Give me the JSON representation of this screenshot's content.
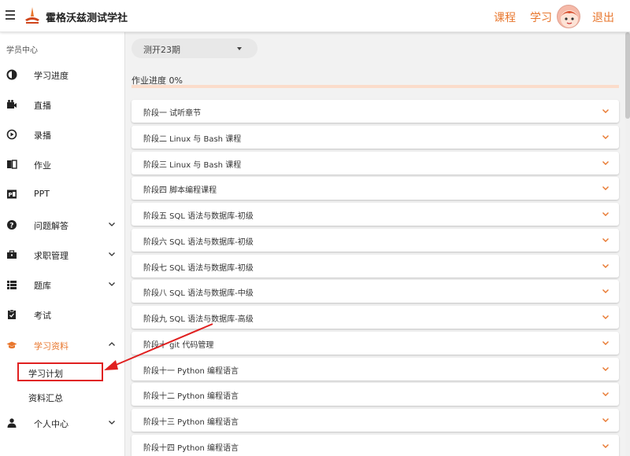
{
  "header": {
    "title": "霍格沃兹测试学社",
    "nav_course": "课程",
    "nav_study": "学习",
    "nav_logout": "退出",
    "accent_color": "#e8772e"
  },
  "sidebar": {
    "heading": "学员中心",
    "items": [
      {
        "label": "学习进度",
        "icon": "pie-chart-icon"
      },
      {
        "label": "直播",
        "icon": "video-camera-icon"
      },
      {
        "label": "录播",
        "icon": "play-circle-icon"
      },
      {
        "label": "作业",
        "icon": "book-icon"
      },
      {
        "label": "PPT",
        "icon": "ppt-icon"
      },
      {
        "label": "问题解答",
        "icon": "question-icon"
      },
      {
        "label": "求职管理",
        "icon": "briefcase-icon"
      },
      {
        "label": "题库",
        "icon": "list-icon"
      },
      {
        "label": "考试",
        "icon": "clipboard-icon"
      },
      {
        "label": "学习资料",
        "icon": "graduation-cap-icon"
      },
      {
        "label": "个人中心",
        "icon": "person-icon"
      }
    ],
    "sub_items": [
      "学习计划",
      "资料汇总"
    ]
  },
  "main": {
    "period_select": "测开23期",
    "progress_label": "作业进度 0%",
    "progress_value": 0,
    "stages": [
      "阶段一 试听章节",
      "阶段二 Linux 与 Bash 课程",
      "阶段三 Linux 与 Bash 课程",
      "阶段四 脚本编程课程",
      "阶段五 SQL 语法与数据库-初级",
      "阶段六 SQL 语法与数据库-初级",
      "阶段七 SQL 语法与数据库-初级",
      "阶段八 SQL 语法与数据库-中级",
      "阶段九 SQL 语法与数据库-高级",
      "阶段十 git 代码管理",
      "阶段十一 Python 编程语言",
      "阶段十二 Python 编程语言",
      "阶段十三 Python 编程语言",
      "阶段十四 Python 编程语言"
    ]
  }
}
